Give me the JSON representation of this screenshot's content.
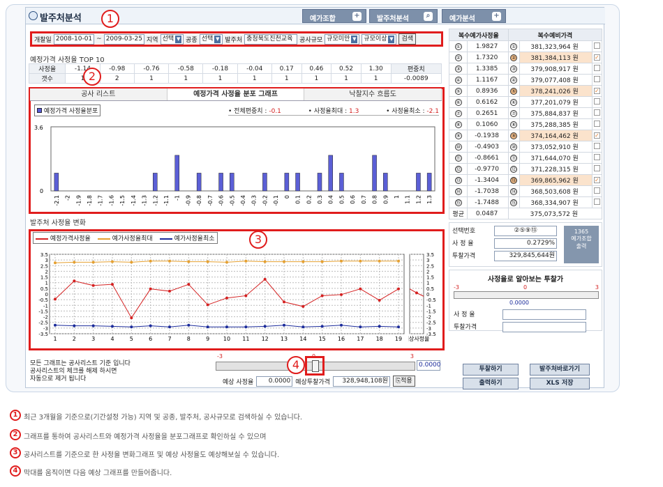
{
  "window": {
    "title": "발주처분석",
    "buttons": [
      "예가조합",
      "발주처분석",
      "예가분석"
    ]
  },
  "filter": {
    "period_label": "개찰일",
    "date_from": "2008-10-01",
    "dash": "~",
    "date_to": "2009-03-25",
    "region_label": "지역",
    "region_value": "선택",
    "type_label": "공종",
    "type_value": "선택",
    "client_label": "발주처",
    "client_value": "충청북도진천교육",
    "scale_label": "공사규모",
    "scale_from": "규모미만",
    "scale_to": "규모이상",
    "search_button": "검색"
  },
  "top10": {
    "title": "예정가격 사정율 TOP 10",
    "row1_label": "사정율",
    "row2_label": "갯수",
    "rates": [
      "-1.14",
      "-0.98",
      "-0.76",
      "-0.58",
      "-0.18",
      "-0.04",
      "0.17",
      "0.46",
      "0.52",
      "1.30"
    ],
    "counts": [
      "1",
      "2",
      "1",
      "1",
      "1",
      "1",
      "1",
      "1",
      "1",
      "1"
    ],
    "dev_label": "편중치",
    "dev_value": "-0.0089"
  },
  "tabs": [
    "공사 리스트",
    "예정가격 사정율 분포 그래프",
    "낙찰지수 흐름도"
  ],
  "dist_chart": {
    "legend": "예정가격 사정율분포",
    "stat1_label": "• 전체편중치 :",
    "stat1_value": "-0.1",
    "stat2_label": "• 사정율최대 :",
    "stat2_value": "1.3",
    "stat3_label": "• 사정율최소 :",
    "stat3_value": "-2.1",
    "ymax": "3.6",
    "ymin": "0"
  },
  "change": {
    "title": "발주처 사정율 변화",
    "legend": [
      "예정가격사정율",
      "예가사정율최대",
      "예가사정율최소"
    ],
    "side_label": "예상\n사정율"
  },
  "note": {
    "line1": "모든 그래프는 공사리스트 기준 입니다",
    "line2": "공사리스트의 체크를 해제 하시면",
    "line3": "자동으로 제거 됩니다"
  },
  "slider": {
    "min": "-3",
    "mid": "0",
    "max": "3",
    "value": "0.0000",
    "fraction": 0.5
  },
  "predict": {
    "rate_label": "예상 사정율",
    "rate_value": "0.0000",
    "price_label": "예상투찰가격",
    "price_value": "328,948,108원",
    "apply_button": "적용"
  },
  "right": {
    "col1_header": "복수예가사정율",
    "col2_header": "복수예비가격",
    "rows": [
      [
        "①",
        "1.9827",
        "381,323,964 원",
        false
      ],
      [
        "②",
        "1.7320",
        "381,384,113 원",
        true
      ],
      [
        "③",
        "1.3385",
        "379,908,917 원",
        false
      ],
      [
        "④",
        "1.1167",
        "379,077,408 원",
        false
      ],
      [
        "⑤",
        "0.8936",
        "378,241,026 원",
        true
      ],
      [
        "⑥",
        "0.6162",
        "377,201,079 원",
        false
      ],
      [
        "⑦",
        "0.2651",
        "375,884,837 원",
        false
      ],
      [
        "⑧",
        "0.1060",
        "375,288,385 원",
        false
      ],
      [
        "⑨",
        "-0.1938",
        "374,164,462 원",
        true
      ],
      [
        "⑩",
        "-0.4903",
        "373,052,910 원",
        false
      ],
      [
        "⑪",
        "-0.8661",
        "371,644,070 원",
        false
      ],
      [
        "⑫",
        "-0.9770",
        "371,228,315 원",
        false
      ],
      [
        "⑬",
        "-1.3404",
        "369,865,962 원",
        true
      ],
      [
        "⑭",
        "-1.7038",
        "368,503,608 원",
        false
      ],
      [
        "⑮",
        "-1.7488",
        "368,334,907 원",
        false
      ]
    ],
    "avg_label": "평균",
    "avg_rate": "0.0487",
    "avg_price": "375,073,572 원"
  },
  "selection": {
    "sel_label": "선택번호",
    "sel_value": "②⑤⑨⑬",
    "rate_label": "사 정 율",
    "rate_value": "0.2729%",
    "bid_label": "투찰가격",
    "bid_value": "329,845,644원",
    "side_btn": "1365\n예가조합\n출력"
  },
  "calc": {
    "title": "사정율로 알아보는 투찰가",
    "min": "-3",
    "mid": "0",
    "max": "3",
    "value": "0.0000",
    "rate_label": "사 정 율",
    "bid_label": "투찰가격"
  },
  "buttons": [
    "투찰하기",
    "발주처바로가기",
    "출력하기",
    "XLS 저장"
  ],
  "annotations": [
    "최근 3개월을 기준으로(기간설정 가능) 지역 및 공종, 발주처, 공사규모로 검색하실 수 있습니다.",
    "그래프를 통하여 공사리스트와 예정가격 사정율을 분포그래프로 확인하실 수 있으며",
    "공사리스트를 기준으로 한 사정율 변화그래프 및 예상 사정율도 예상해보실 수 있습니다.",
    "막대를 움직이면 다음 예상 그래프를 만들어줍니다."
  ],
  "chart_data": [
    {
      "type": "bar",
      "title": "예정가격 사정율 분포 그래프",
      "categories": [
        "-2.1",
        "-2",
        "-1.9",
        "-1.8",
        "-1.7",
        "-1.6",
        "-1.5",
        "-1.4",
        "-1.3",
        "-1.2",
        "-1.1",
        "-1",
        "-0.9",
        "-0.8",
        "-0.7",
        "-0.6",
        "-0.5",
        "-0.4",
        "-0.3",
        "-0.2",
        "-0.1",
        "0",
        "0.1",
        "0.2",
        "0.3",
        "0.4",
        "0.5",
        "0.6",
        "0.7",
        "0.8",
        "0.9",
        "1",
        "1.1",
        "1.2",
        "1.3"
      ],
      "values": [
        1,
        0,
        0,
        0,
        0,
        0,
        0,
        0,
        0,
        1,
        0,
        2,
        0,
        1,
        0,
        1,
        1,
        0,
        0,
        1,
        0,
        1,
        1,
        0,
        1,
        2,
        1,
        0,
        0,
        2,
        1,
        0,
        0,
        1,
        1
      ],
      "ylim": [
        0,
        3.6
      ]
    },
    {
      "type": "line",
      "title": "발주처 사정율 변화",
      "x": [
        1,
        2,
        3,
        4,
        5,
        6,
        7,
        8,
        9,
        10,
        11,
        12,
        13,
        14,
        15,
        16,
        17,
        18,
        19
      ],
      "ylim": [
        -3.5,
        3.5
      ],
      "series": [
        {
          "name": "예정가격사정율",
          "color": "#d42020",
          "values": [
            -0.45,
            1.15,
            0.75,
            0.85,
            -2.1,
            0.45,
            0.25,
            0.85,
            -0.95,
            -0.35,
            -0.15,
            1.3,
            -0.7,
            -1.1,
            -0.15,
            -0.05,
            0.45,
            -0.55,
            0.45
          ]
        },
        {
          "name": "예가사정율최대",
          "color": "#e5a030",
          "values": [
            2.75,
            2.8,
            2.8,
            2.85,
            2.8,
            2.9,
            2.9,
            2.85,
            2.85,
            2.8,
            2.9,
            2.85,
            2.85,
            2.85,
            2.85,
            2.9,
            2.9,
            2.9,
            2.9
          ]
        },
        {
          "name": "예가사정율최소",
          "color": "#1a2a9a",
          "values": [
            -2.75,
            -2.8,
            -2.8,
            -2.85,
            -2.9,
            -2.8,
            -2.9,
            -2.75,
            -2.9,
            -2.9,
            -2.9,
            -2.85,
            -2.75,
            -2.9,
            -2.85,
            -2.75,
            -2.9,
            -2.85,
            -2.9
          ]
        }
      ]
    }
  ]
}
